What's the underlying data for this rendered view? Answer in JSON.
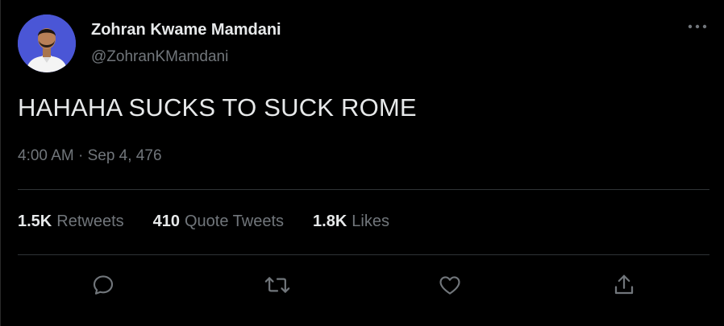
{
  "user": {
    "display_name": "Zohran Kwame Mamdani",
    "handle": "@ZohranKMamdani",
    "avatar_bg": "#4a56d6"
  },
  "tweet": {
    "text": "HAHAHA SUCKS TO SUCK ROME",
    "timestamp": "4:00 AM · Sep 4, 476"
  },
  "stats": {
    "retweets_count": "1.5K",
    "retweets_label": "Retweets",
    "quotes_count": "410",
    "quotes_label": "Quote Tweets",
    "likes_count": "1.8K",
    "likes_label": "Likes"
  },
  "icons": {
    "more": "more-horizontal-icon",
    "reply": "reply-icon",
    "retweet": "retweet-icon",
    "like": "heart-icon",
    "share": "share-icon"
  },
  "colors": {
    "background": "#000000",
    "primary_text": "#e7e9ea",
    "secondary_text": "#71767b",
    "divider": "#2f3336"
  }
}
